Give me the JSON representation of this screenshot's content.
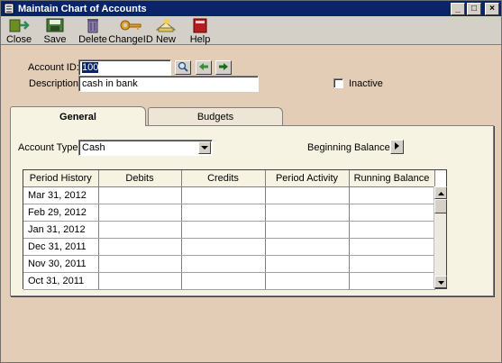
{
  "window": {
    "title": "Maintain Chart of Accounts",
    "minimize_glyph": "_",
    "maximize_glyph": "□",
    "close_glyph": "×"
  },
  "toolbar": {
    "items": [
      {
        "label": "Close",
        "icon": "close-door-icon"
      },
      {
        "label": "Save",
        "icon": "save-icon"
      },
      {
        "label": "Delete",
        "icon": "delete-icon"
      },
      {
        "label": "ChangeID",
        "icon": "key-icon"
      },
      {
        "label": "New",
        "icon": "new-icon"
      },
      {
        "label": "Help",
        "icon": "help-book-icon"
      }
    ]
  },
  "form": {
    "account_id_label": "Account ID:",
    "account_id_value": "100",
    "description_label": "Description:",
    "description_value": "cash in bank",
    "inactive_label": "Inactive",
    "inactive_checked": false
  },
  "tabs": [
    {
      "label": "General",
      "active": true
    },
    {
      "label": "Budgets",
      "active": false
    }
  ],
  "general": {
    "account_type_label": "Account Type:",
    "account_type_value": "Cash",
    "beginning_balances_label": "Beginning Balances:"
  },
  "history_table": {
    "columns": [
      "Period History",
      "Debits",
      "Credits",
      "Period Activity",
      "Running Balance"
    ],
    "rows": [
      {
        "period": "Mar 31, 2012",
        "debits": "",
        "credits": "",
        "activity": "",
        "balance": ""
      },
      {
        "period": "Feb 29, 2012",
        "debits": "",
        "credits": "",
        "activity": "",
        "balance": ""
      },
      {
        "period": "Jan 31, 2012",
        "debits": "",
        "credits": "",
        "activity": "",
        "balance": ""
      },
      {
        "period": "Dec 31, 2011",
        "debits": "",
        "credits": "",
        "activity": "",
        "balance": ""
      },
      {
        "period": "Nov 30, 2011",
        "debits": "",
        "credits": "",
        "activity": "",
        "balance": ""
      },
      {
        "period": "Oct 31, 2011",
        "debits": "",
        "credits": "",
        "activity": "",
        "balance": ""
      }
    ]
  },
  "colors": {
    "background": "#e3cdb6",
    "titlebar": "#0a246a",
    "panel": "#f7f3e3",
    "selection": "#0a246a"
  }
}
